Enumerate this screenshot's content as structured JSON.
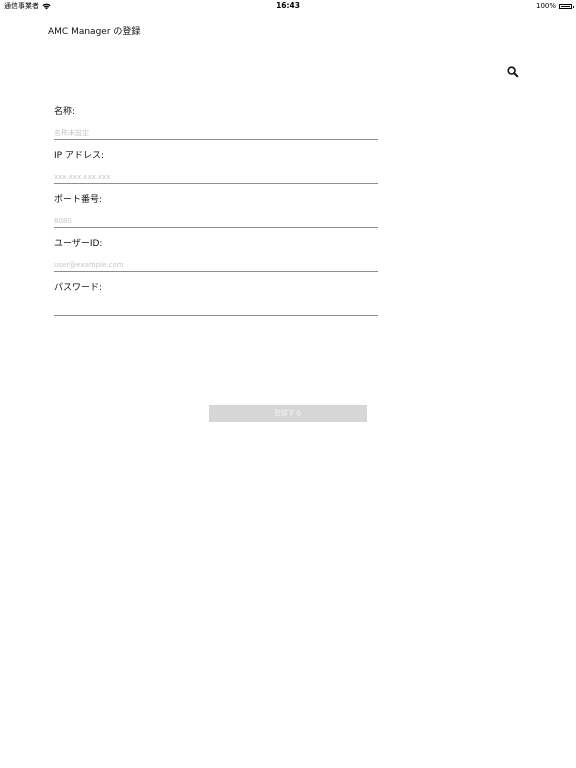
{
  "status_bar": {
    "carrier": "通信事業者",
    "time": "16:43",
    "battery_text": "100%"
  },
  "nav": {
    "title": "AMC Manager の登録",
    "search_icon": "search-icon"
  },
  "form": {
    "fields": [
      {
        "label": "名称:",
        "placeholder": "名称未設定",
        "value": ""
      },
      {
        "label": "IP アドレス:",
        "placeholder": "xxx.xxx.xxx.xxx",
        "value": ""
      },
      {
        "label": "ポート番号:",
        "placeholder": "8080",
        "value": ""
      },
      {
        "label": "ユーザーID:",
        "placeholder": "user@example.com",
        "value": ""
      },
      {
        "label": "パスワード:",
        "placeholder": "",
        "value": ""
      }
    ],
    "submit_label": "登録する",
    "submit_enabled": false
  }
}
